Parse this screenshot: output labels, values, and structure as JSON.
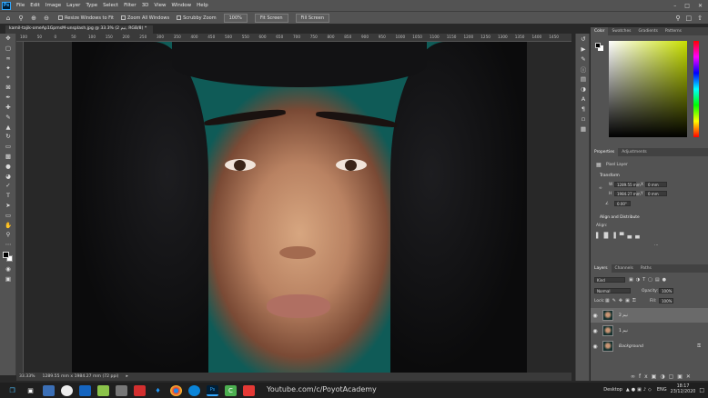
{
  "menubar": {
    "logo": "Ps",
    "items": [
      "File",
      "Edit",
      "Image",
      "Layer",
      "Type",
      "Select",
      "Filter",
      "3D",
      "View",
      "Window",
      "Help"
    ]
  },
  "optionsbar": {
    "resize_windows": "Resize Windows to Fit",
    "zoom_all": "Zoom All Windows",
    "scrubby_zoom": "Scrubby Zoom",
    "zoom_pct": "100%",
    "fit_screen": "Fit Screen",
    "fill_screen": "Fill Screen"
  },
  "document": {
    "tab_title": "kamil-tajik-omeAp1GpmsM-unsplash.jpg @ 33.3% (2 نیم, RGB/8) *",
    "ruler_ticks": [
      "100",
      "50",
      "0",
      "50",
      "100",
      "150",
      "200",
      "250",
      "300",
      "350",
      "400",
      "450",
      "500",
      "550",
      "600",
      "650",
      "700",
      "750",
      "800",
      "850",
      "900",
      "950",
      "1000",
      "1050",
      "1100",
      "1150",
      "1200",
      "1250",
      "1300",
      "1350",
      "1400",
      "1450"
    ],
    "status_zoom": "33.33%",
    "status_size": "1289.55 mm x 1984.27 mm (72 ppi)"
  },
  "color_panel": {
    "tabs": [
      "Color",
      "Swatches",
      "Gradients",
      "Patterns"
    ]
  },
  "properties_panel": {
    "tabs": [
      "Properties",
      "Adjustments"
    ],
    "layer_type": "Pixel Layer",
    "transform_label": "Transform",
    "w_label": "W",
    "w_value": "1289.55 mm",
    "h_label": "H",
    "h_value": "1984.27 mm",
    "x_label": "X",
    "x_value": "0 mm",
    "y_label": "Y",
    "y_value": "0 mm",
    "angle_value": "0.00°",
    "align_label": "Align and Distribute",
    "align_sub": "Align:"
  },
  "layers_panel": {
    "tabs": [
      "Layers",
      "Channels",
      "Paths"
    ],
    "kind_label": "Kind",
    "blend_mode": "Normal",
    "opacity_label": "Opacity:",
    "opacity_value": "100%",
    "lock_label": "Lock:",
    "fill_label": "Fill:",
    "fill_value": "100%",
    "layers": [
      {
        "name": "2 نیم",
        "selected": true
      },
      {
        "name": "1 نیم",
        "selected": false
      },
      {
        "name": "Background",
        "selected": false
      }
    ]
  },
  "taskbar": {
    "url": "Youtube.com/c/PoyotAcademy",
    "desktop": "Desktop",
    "lang": "ENG",
    "time": "18:17",
    "date": "23/12/2020"
  },
  "colors": {
    "ps_bg": "#535353",
    "photo_teal": "#0f5b57",
    "accent": "#31a8ff"
  }
}
